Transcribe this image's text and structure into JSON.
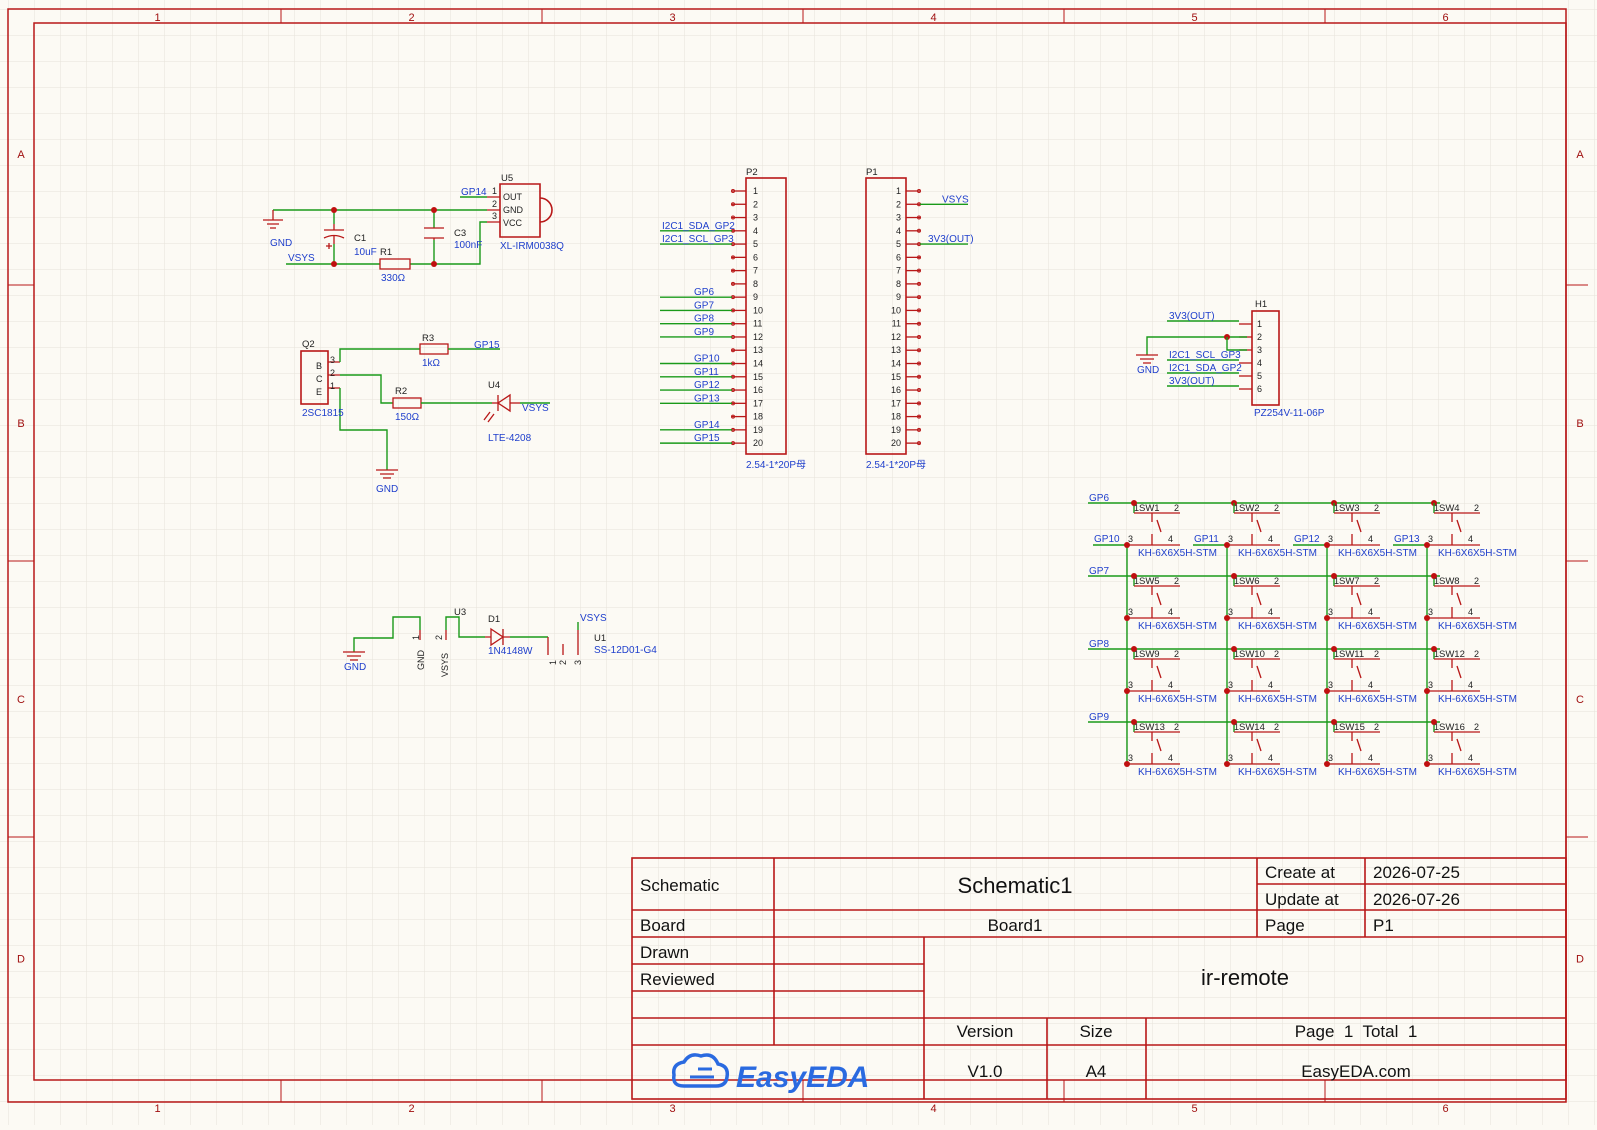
{
  "ruler": {
    "cols": [
      "1",
      "2",
      "3",
      "4",
      "5",
      "6"
    ],
    "rows": [
      "A",
      "B",
      "C",
      "D"
    ]
  },
  "title_block": {
    "schematic_label": "Schematic",
    "schematic_name": "Schematic1",
    "create_label": "Create at",
    "create_date": "2026-07-25",
    "update_label": "Update at",
    "update_date": "2026-07-26",
    "board_label": "Board",
    "board_name": "Board1",
    "page_label": "Page",
    "page_value": "P1",
    "drawn_label": "Drawn",
    "reviewed_label": "Reviewed",
    "project": "ir-remote",
    "version_label": "Version",
    "version": "V1.0",
    "size_label": "Size",
    "size": "A4",
    "page_total": "Page  1  Total  1",
    "logo_text": "EasyEDA",
    "site": "EasyEDA.com"
  },
  "ir_receiver": {
    "gp14": "GP14",
    "gnd": "GND",
    "vsys": "VSYS",
    "c1": "C1",
    "c1_val": "10uF",
    "r1": "R1",
    "r1_val": "330Ω",
    "c3": "C3",
    "c3_val": "100nF",
    "u5": "U5",
    "u5_part": "XL-IRM0038Q",
    "pin_out": "OUT",
    "pin_gnd": "GND",
    "pin_vcc": "VCC",
    "n1": "1",
    "n2": "2",
    "n3": "3"
  },
  "ir_led": {
    "q2": "Q2",
    "q2_part": "2SC1815",
    "b": "B",
    "c": "C",
    "e": "E",
    "n3": "3",
    "n2": "2",
    "n1": "1",
    "r3": "R3",
    "r3_val": "1kΩ",
    "gp15": "GP15",
    "r2": "R2",
    "r2_val": "150Ω",
    "u4": "U4",
    "u4_part": "LTE-4208",
    "vsys": "VSYS",
    "gnd": "GND"
  },
  "power": {
    "gnd": "GND",
    "u3": "U3",
    "p_gnd": "GND",
    "p_vsys": "VSYS",
    "n1": "1",
    "n2": "2",
    "d1": "D1",
    "d1_part": "1N4148W",
    "vsys": "VSYS",
    "u1": "U1",
    "u1_part": "SS-12D01-G4",
    "s1": "1",
    "s2": "2",
    "s3": "3"
  },
  "p2": {
    "name": "P2",
    "part": "2.54-1*20P母",
    "pins": [
      "1",
      "2",
      "3",
      "4",
      "5",
      "6",
      "7",
      "8",
      "9",
      "10",
      "11",
      "12",
      "13",
      "14",
      "15",
      "16",
      "17",
      "18",
      "19",
      "20"
    ],
    "nets": [
      "",
      "",
      "",
      "I2C1_SDA_GP2",
      "I2C1_SCL_GP3",
      "",
      "",
      "",
      "GP6",
      "GP7",
      "GP8",
      "GP9",
      "",
      "GP10",
      "GP11",
      "GP12",
      "GP13",
      "",
      "GP14",
      "GP15"
    ]
  },
  "p1": {
    "name": "P1",
    "part": "2.54-1*20P母",
    "pins": [
      "1",
      "2",
      "3",
      "4",
      "5",
      "6",
      "7",
      "8",
      "9",
      "10",
      "11",
      "12",
      "13",
      "14",
      "15",
      "16",
      "17",
      "18",
      "19",
      "20"
    ],
    "nets": [
      "",
      "VSYS",
      "",
      "",
      "3V3(OUT)",
      "",
      "",
      "",
      "",
      "",
      "",
      "",
      "",
      "",
      "",
      "",
      "",
      "",
      "",
      ""
    ]
  },
  "h1": {
    "name": "H1",
    "part": "PZ254V-11-06P",
    "pins": [
      "1",
      "2",
      "3",
      "4",
      "5",
      "6"
    ],
    "nets": [
      "3V3(OUT)",
      "",
      "",
      "I2C1_SCL_GP3",
      "I2C1_SDA_GP2",
      "3V3(OUT)"
    ],
    "gnd": "GND"
  },
  "keypad": {
    "row_nets": [
      "GP6",
      "GP7",
      "GP8",
      "GP9"
    ],
    "col_nets": [
      "GP10",
      "GP11",
      "GP12",
      "GP13"
    ],
    "switches": [
      "SW1",
      "SW2",
      "SW3",
      "SW4",
      "SW5",
      "SW6",
      "SW7",
      "SW8",
      "SW9",
      "SW10",
      "SW11",
      "SW12",
      "SW13",
      "SW14",
      "SW15",
      "SW16"
    ],
    "part": "KH-6X6X5H-STM",
    "n1": "1",
    "n2": "2",
    "n3": "3",
    "n4": "4"
  }
}
